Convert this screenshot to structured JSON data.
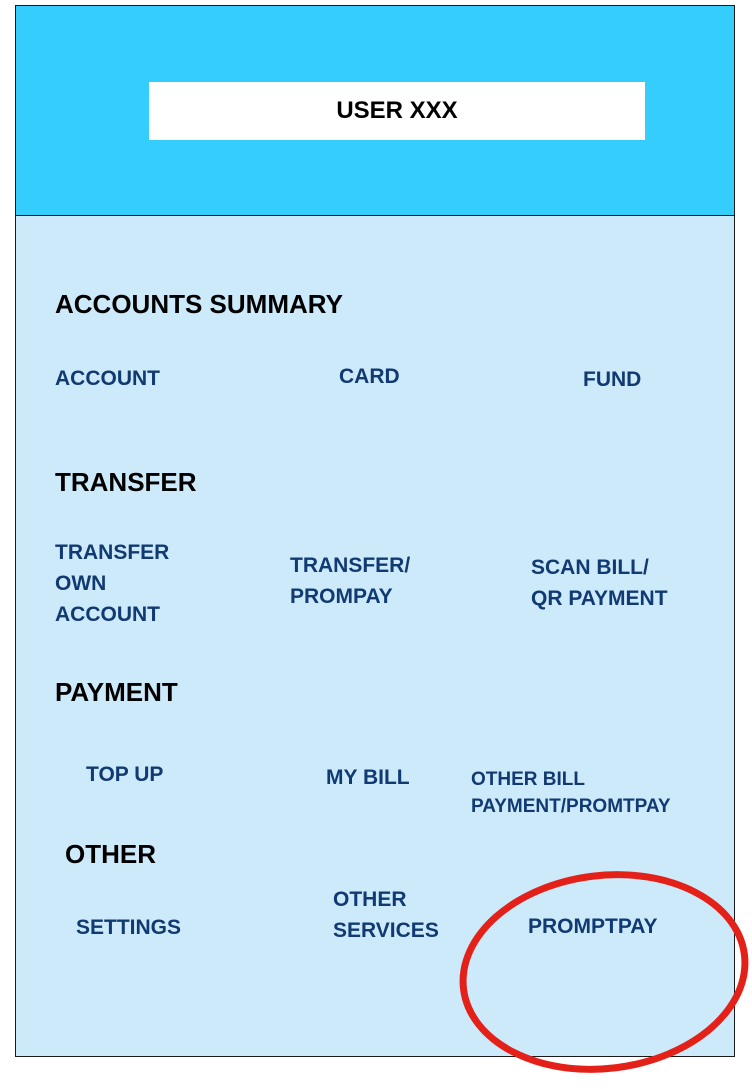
{
  "header": {
    "user_label": "USER XXX"
  },
  "sections": {
    "accounts_summary": {
      "title": "ACCOUNTS SUMMARY",
      "items": {
        "account": "ACCOUNT",
        "card": "CARD",
        "fund": "FUND"
      }
    },
    "transfer": {
      "title": "TRANSFER",
      "items": {
        "own_account": [
          "TRANSFER",
          "OWN",
          "ACCOUNT"
        ],
        "prompay": [
          "TRANSFER/",
          "PROMPAY"
        ],
        "scan_bill": [
          "SCAN BILL/",
          "QR PAYMENT"
        ]
      }
    },
    "payment": {
      "title": "PAYMENT",
      "items": {
        "top_up": "TOP UP",
        "my_bill": "MY BILL",
        "other_bill": [
          "OTHER BILL",
          "PAYMENT/PROMTPAY"
        ]
      }
    },
    "other": {
      "title": "OTHER",
      "items": {
        "settings": "SETTINGS",
        "other_services": [
          "OTHER",
          "SERVICES"
        ],
        "promptpay": "PROMPTPAY"
      }
    }
  },
  "colors": {
    "header_bg": "#35cdfc",
    "body_bg": "#cdeafb",
    "item_text": "#113a73",
    "highlight": "#e32119"
  }
}
